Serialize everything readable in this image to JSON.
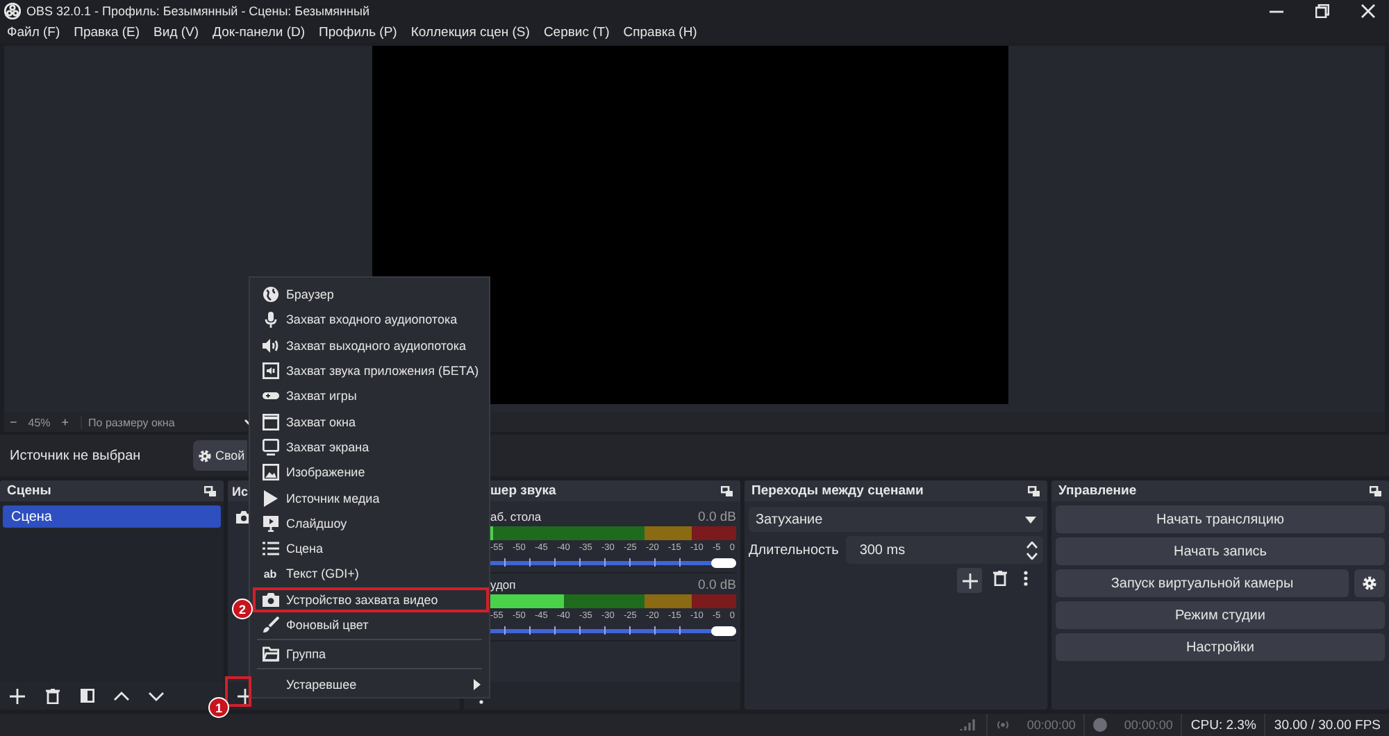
{
  "window": {
    "title": "OBS 32.0.1 - Профиль: Безымянный - Сцены: Безымянный"
  },
  "menu_bar": [
    "Файл (F)",
    "Правка (E)",
    "Вид (V)",
    "Док-панели (D)",
    "Профиль (P)",
    "Коллекция сцен (S)",
    "Сервис (T)",
    "Справка (H)"
  ],
  "preview": {
    "zoom_out": "−",
    "zoom": "45%",
    "zoom_in": "+",
    "scale_mode": "По размеру окна"
  },
  "source_bar": {
    "label": "Источник не выбран",
    "properties_button": "Свой"
  },
  "scenes_dock": {
    "title": "Сцены",
    "items": [
      {
        "label": "Сцена",
        "selected": true
      }
    ]
  },
  "sources_dock": {
    "title": "Ис"
  },
  "mixer_dock": {
    "title": "шер звука",
    "channels": [
      {
        "name": "аб. стола",
        "reading": "0.0 dB",
        "level": 0,
        "ticks": [
          "-55",
          "-50",
          "-45",
          "-40",
          "-35",
          "-30",
          "-25",
          "-20",
          "-15",
          "-10",
          "-5",
          "0"
        ],
        "volume": {
          "level": 1
        }
      },
      {
        "name": "удоп",
        "reading": "0.0 dB",
        "level": 0.3,
        "ticks": [
          "-55",
          "-50",
          "-45",
          "-40",
          "-35",
          "-30",
          "-25",
          "-20",
          "-15",
          "-10",
          "-5",
          "0"
        ],
        "volume": {
          "level": 1
        }
      }
    ]
  },
  "transitions_dock": {
    "title": "Переходы между сценами",
    "transition": "Затухание",
    "duration_label": "Длительность",
    "duration": "300 ms"
  },
  "controls_dock": {
    "title": "Управление",
    "buttons": [
      {
        "label": "Начать трансляцию",
        "settings": false
      },
      {
        "label": "Начать запись",
        "settings": false
      },
      {
        "label": "Запуск виртуальной камеры",
        "settings": true
      },
      {
        "label": "Режим студии",
        "settings": false
      },
      {
        "label": "Настройки",
        "settings": false
      }
    ]
  },
  "add_source_menu": {
    "items": [
      {
        "kind": "item",
        "label": "Браузер"
      },
      {
        "kind": "item",
        "label": "Захват входного аудиопотока"
      },
      {
        "kind": "item",
        "label": "Захват выходного аудиопотока"
      },
      {
        "kind": "item",
        "label": "Захват звука приложения (БЕТА)"
      },
      {
        "kind": "item",
        "label": "Захват игры"
      },
      {
        "kind": "item",
        "label": "Захват окна"
      },
      {
        "kind": "item",
        "label": "Захват экрана"
      },
      {
        "kind": "item",
        "label": "Изображение"
      },
      {
        "kind": "item",
        "label": "Источник медиа"
      },
      {
        "kind": "item",
        "label": "Слайдшоу"
      },
      {
        "kind": "item",
        "label": "Сцена"
      },
      {
        "kind": "item",
        "label": "Текст (GDI+)",
        "glyph": "ab"
      },
      {
        "kind": "item",
        "label": "Устройство захвата видео",
        "highlighted": true
      },
      {
        "kind": "item",
        "label": "Фоновый цвет"
      },
      {
        "kind": "separator"
      },
      {
        "kind": "item",
        "label": "Группа"
      },
      {
        "kind": "separator"
      },
      {
        "kind": "submenu",
        "label": "Устаревшее"
      }
    ]
  },
  "annotations": [
    {
      "label": "1",
      "frame": true
    },
    {
      "label": "2",
      "frame": false
    }
  ],
  "status_bar": {
    "stream_time": "00:00:00",
    "record_time": "00:00:00",
    "cpu": "CPU: 2.3%",
    "fps": "30.00 / 30.00 FPS"
  }
}
